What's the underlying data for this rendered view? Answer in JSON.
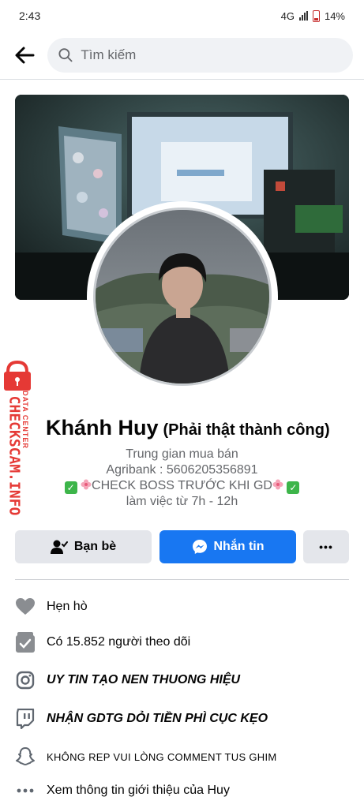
{
  "status_bar": {
    "time": "2:43",
    "network": "4G",
    "battery": "14%"
  },
  "header": {
    "search_placeholder": "Tìm kiếm"
  },
  "profile": {
    "name": "Khánh Huy",
    "nickname": "(Phải thật thành công)",
    "bio": {
      "line1": "Trung gian mua bán",
      "line2": "Agribank : 5606205356891",
      "line3": "CHECK BOSS TRƯỚC KHI GD",
      "line4": "làm việc từ 7h - 12h"
    }
  },
  "watermark": {
    "brand": "CHECKSCAM.INFO",
    "sub": "DATA CENTER"
  },
  "actions": {
    "friends_label": "Bạn bè",
    "message_label": "Nhắn tin",
    "more_label": "•••"
  },
  "details": [
    {
      "icon": "heart-icon",
      "text": "Hẹn hò"
    },
    {
      "icon": "followers-icon",
      "text": "Có 15.852 người theo dõi"
    },
    {
      "icon": "instagram-icon",
      "text": "UY TIN TẠO NEN THUONG HIỆU"
    },
    {
      "icon": "twitch-icon",
      "text": "NHẬN GDTG DỎI TIỀN PHÌ CỤC KẸO"
    },
    {
      "icon": "snapchat-icon",
      "text": "KHÔNG REP VUI LÒNG COMMENT TUS GHIM"
    },
    {
      "icon": "more-dots-icon",
      "text": "Xem thông tin giới thiệu của Huy"
    }
  ],
  "colors": {
    "accent": "#1877f2",
    "watermark_red": "#e53935",
    "checkmark_green": "#3db54a"
  }
}
